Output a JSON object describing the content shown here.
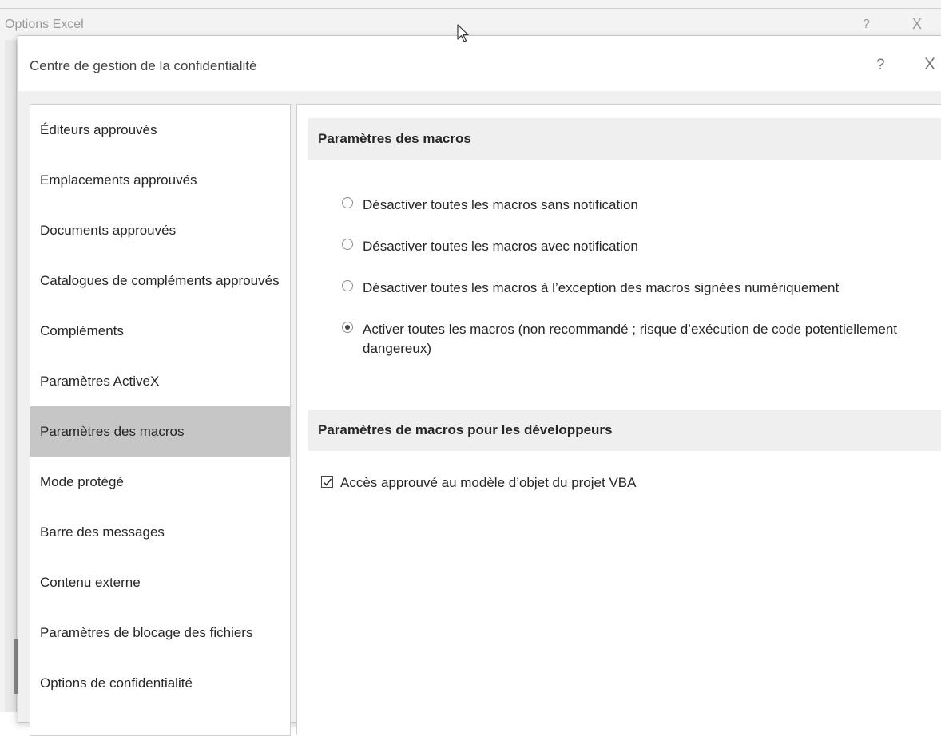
{
  "parent_window": {
    "title": "Options Excel",
    "help_label": "?",
    "close_label": "X"
  },
  "dialog": {
    "title": "Centre de gestion de la confidentialité",
    "help_label": "?",
    "close_label": "X"
  },
  "nav": {
    "selected_index": 6,
    "items": [
      {
        "label": "Éditeurs approuvés"
      },
      {
        "label": "Emplacements approuvés"
      },
      {
        "label": "Documents approuvés"
      },
      {
        "label": "Catalogues de compléments approuvés"
      },
      {
        "label": "Compléments"
      },
      {
        "label": "Paramètres ActiveX"
      },
      {
        "label": "Paramètres des macros"
      },
      {
        "label": "Mode protégé"
      },
      {
        "label": "Barre des messages"
      },
      {
        "label": "Contenu externe"
      },
      {
        "label": "Paramètres de blocage des fichiers"
      },
      {
        "label": "Options de confidentialité"
      }
    ]
  },
  "macros": {
    "header": "Paramètres des macros",
    "options": [
      {
        "label": "Désactiver toutes les macros sans notification",
        "checked": false
      },
      {
        "label": "Désactiver toutes les macros avec notification",
        "checked": false
      },
      {
        "label": "Désactiver toutes les macros à l’exception des macros signées numériquement",
        "checked": false
      },
      {
        "label": "Activer toutes les macros (non recommandé ; risque d’exécution de code potentiellement dangereux)",
        "checked": true
      }
    ]
  },
  "developer": {
    "header": "Paramètres de macros pour les développeurs",
    "vba_access_label": "Accès approuvé au modèle d’objet du projet VBA",
    "vba_access_checked": true
  }
}
